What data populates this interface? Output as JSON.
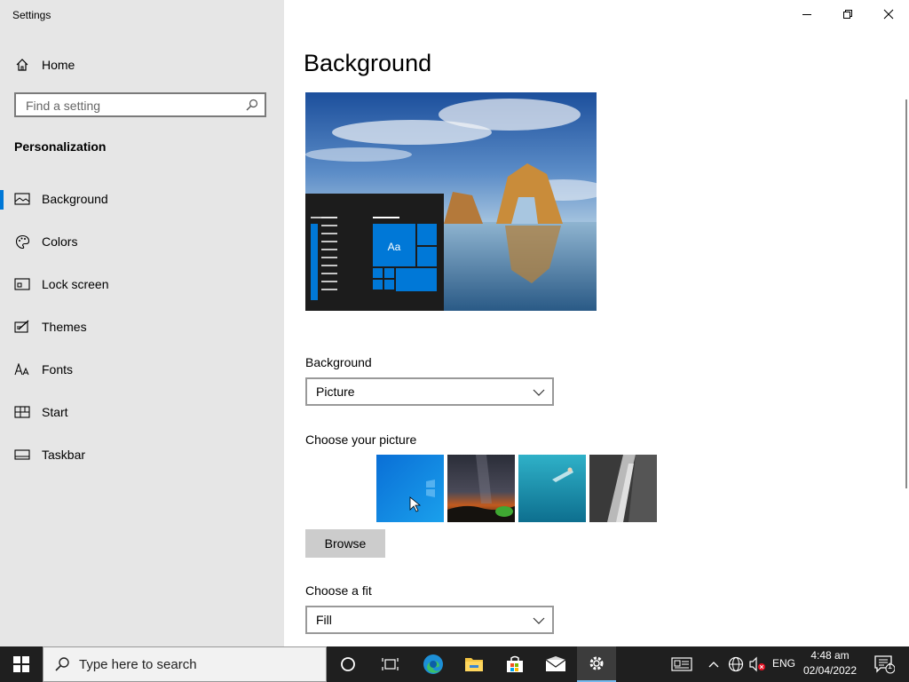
{
  "window": {
    "title": "Settings"
  },
  "sidebar": {
    "home_label": "Home",
    "search_placeholder": "Find a setting",
    "section_title": "Personalization",
    "items": [
      {
        "label": "Background",
        "icon": "picture-icon",
        "active": true
      },
      {
        "label": "Colors",
        "icon": "palette-icon",
        "active": false
      },
      {
        "label": "Lock screen",
        "icon": "lock-screen-icon",
        "active": false
      },
      {
        "label": "Themes",
        "icon": "themes-icon",
        "active": false
      },
      {
        "label": "Fonts",
        "icon": "fonts-icon",
        "active": false
      },
      {
        "label": "Start",
        "icon": "start-icon",
        "active": false
      },
      {
        "label": "Taskbar",
        "icon": "taskbar-icon",
        "active": false
      }
    ]
  },
  "main": {
    "title": "Background",
    "preview": {
      "tile_label": "Aa"
    },
    "background_label": "Background",
    "background_value": "Picture",
    "choose_picture_label": "Choose your picture",
    "pictures": [
      "windows-blue",
      "night-sky",
      "underwater-swimmer",
      "rock-cliff"
    ],
    "browse_label": "Browse",
    "fit_label": "Choose a fit",
    "fit_value": "Fill"
  },
  "taskbar": {
    "search_placeholder": "Type here to search",
    "language": "ENG",
    "time": "4:48 am",
    "date": "02/04/2022",
    "notification_count": "1"
  },
  "colors": {
    "accent": "#0078d7",
    "sidebar_bg": "#e6e6e6",
    "taskbar_bg": "#1f1f1f"
  }
}
